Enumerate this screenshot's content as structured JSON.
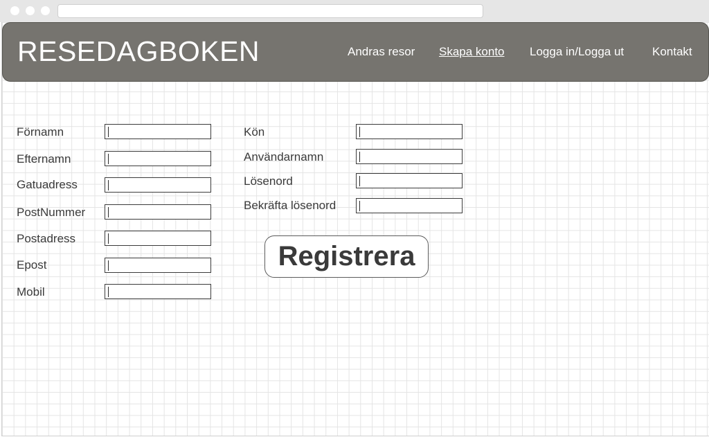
{
  "app": {
    "logo": "RESEDAGBOKEN"
  },
  "nav": {
    "items": [
      {
        "label": "Andras resor",
        "active": false
      },
      {
        "label": "Skapa konto",
        "active": true
      },
      {
        "label": "Logga in/Logga ut",
        "active": false
      },
      {
        "label": "Kontakt",
        "active": false
      }
    ]
  },
  "form": {
    "left_fields": [
      {
        "label": "Förnamn",
        "value": ""
      },
      {
        "label": "Efternamn",
        "value": ""
      },
      {
        "label": "Gatuadress",
        "value": ""
      },
      {
        "label": "PostNummer",
        "value": ""
      },
      {
        "label": "Postadress",
        "value": ""
      },
      {
        "label": "Epost",
        "value": ""
      },
      {
        "label": "Mobil",
        "value": ""
      }
    ],
    "right_fields": [
      {
        "label": "Kön",
        "value": ""
      },
      {
        "label": "Användarnamn",
        "value": ""
      },
      {
        "label": "Lösenord",
        "value": ""
      },
      {
        "label": "Bekräfta lösenord",
        "value": ""
      }
    ],
    "submit_label": "Registrera"
  },
  "colors": {
    "header_bg": "#76746f",
    "text": "#3a3a3a",
    "grid": "#e4e4e4"
  }
}
